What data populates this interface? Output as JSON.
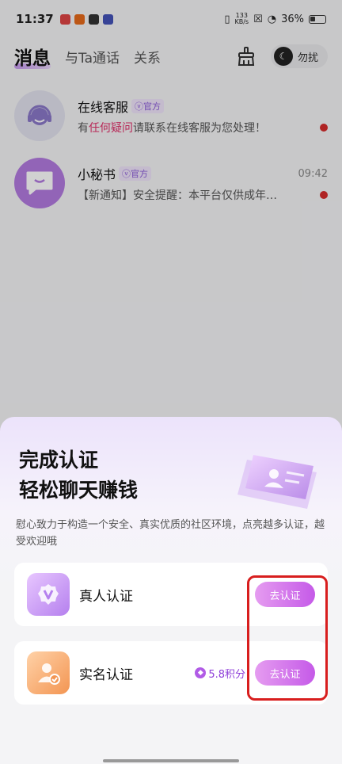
{
  "status_bar": {
    "time": "11:37",
    "net_speed_value": "133",
    "net_speed_unit": "KB/s",
    "battery": "36%"
  },
  "nav": {
    "tabs": [
      {
        "label": "消息",
        "active": true
      },
      {
        "label": "与Ta通话",
        "active": false
      },
      {
        "label": "关系",
        "active": false
      }
    ],
    "dnd_label": "勿扰"
  },
  "conversations": [
    {
      "name": "在线客服",
      "badge": "官方",
      "message_prefix": "有",
      "message_highlight": "任何疑问",
      "message_suffix": "请联系在线客服为您处理！",
      "time": "",
      "unread": true
    },
    {
      "name": "小秘书",
      "badge": "官方",
      "message": "【新通知】安全提醒：本平台仅供成年…",
      "time": "09:42",
      "unread": true
    }
  ],
  "sheet": {
    "title_line1": "完成认证",
    "title_line2": "轻松聊天赚钱",
    "description": "慰心致力于构造一个安全、真实优质的社区环境，点亮越多认证，越受欢迎哦",
    "items": [
      {
        "label": "真人认证",
        "button": "去认证",
        "icon": "v-badge-icon"
      },
      {
        "label": "实名认证",
        "points": "5.8积分",
        "button": "去认证",
        "icon": "user-verified-icon"
      }
    ]
  },
  "colors": {
    "accent": "#c55ae8",
    "highlight_box": "#d81e1e",
    "unread": "#d62b2b"
  }
}
